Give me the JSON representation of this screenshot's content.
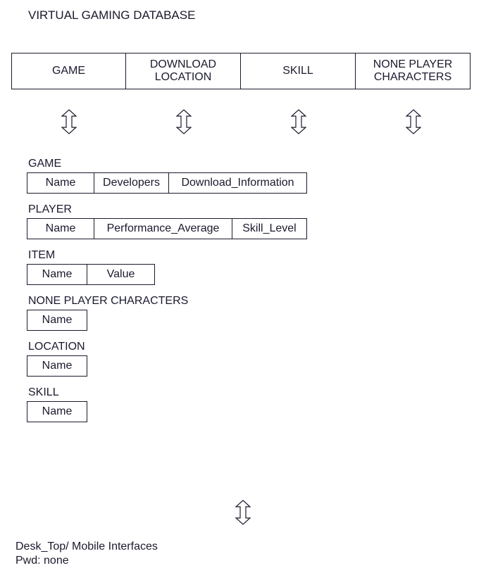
{
  "title": "VIRTUAL GAMING DATABASE",
  "tabs": [
    "GAME",
    "DOWNLOAD LOCATION",
    "SKILL",
    "NONE PLAYER CHARACTERS"
  ],
  "entities": [
    {
      "name": "GAME",
      "fields": [
        "Name",
        "Developers",
        "Download_Information"
      ],
      "widths": [
        96,
        106,
        196
      ]
    },
    {
      "name": "PLAYER",
      "fields": [
        "Name",
        "Performance_Average",
        "Skill_Level"
      ],
      "widths": [
        96,
        196,
        106
      ]
    },
    {
      "name": "ITEM",
      "fields": [
        "Name",
        "Value"
      ],
      "widths": [
        86,
        96
      ]
    },
    {
      "name": "NONE PLAYER CHARACTERS",
      "fields": [
        "Name"
      ],
      "widths": [
        86
      ]
    },
    {
      "name": "LOCATION",
      "fields": [
        "Name"
      ],
      "widths": [
        86
      ]
    },
    {
      "name": "SKILL",
      "fields": [
        "Name"
      ],
      "widths": [
        86
      ]
    }
  ],
  "footer": {
    "line1": "Desk_Top/ Mobile Interfaces",
    "line2": "Pwd: none"
  }
}
